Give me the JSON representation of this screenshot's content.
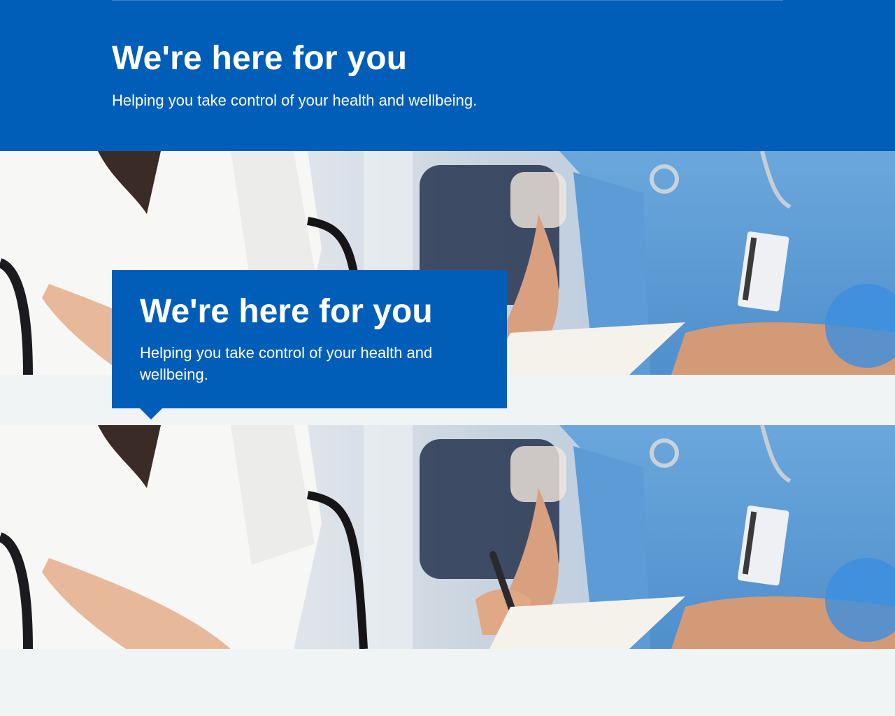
{
  "hero": {
    "title": "We're here for you",
    "subtitle": "Helping you take control of your health and wellbeing."
  },
  "hero_overlay": {
    "title": "We're here for you",
    "subtitle": "Helping you take control of your health and wellbeing."
  },
  "colors": {
    "nhs_blue": "#005eb8",
    "page_background": "#f0f4f5",
    "text_on_blue": "#ffffff"
  }
}
